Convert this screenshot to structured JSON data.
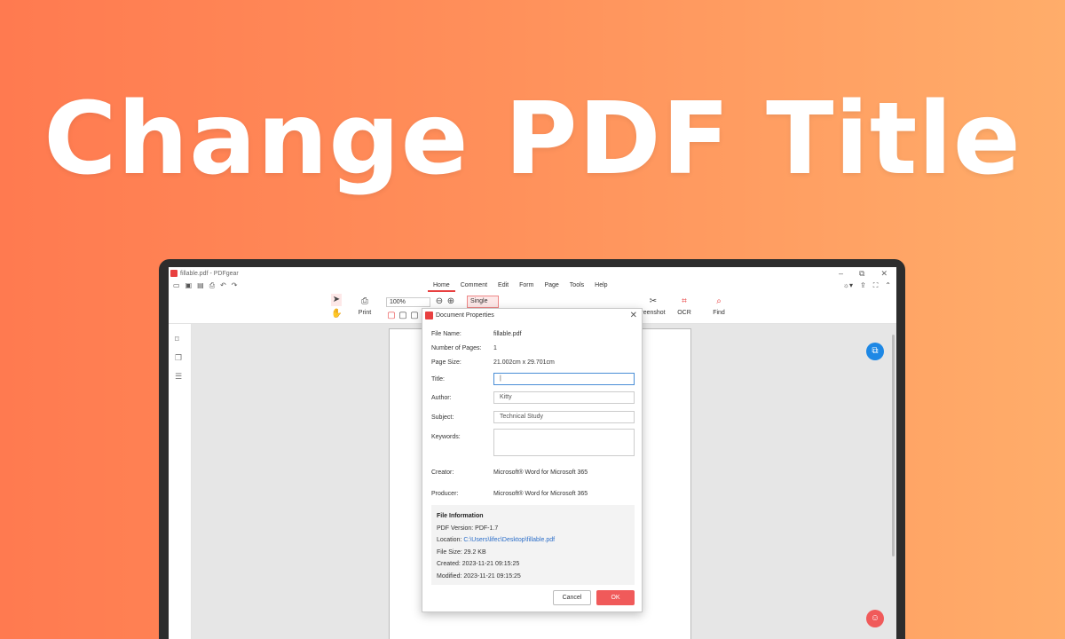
{
  "banner": {
    "title": "Change PDF Title"
  },
  "window": {
    "title": "fillable.pdf - PDFgear",
    "controls": [
      "–",
      "⧉",
      "✕"
    ]
  },
  "menu": {
    "tabs": [
      "Home",
      "Comment",
      "Edit",
      "Form",
      "Page",
      "Tools",
      "Help"
    ],
    "active_tab": "Home"
  },
  "toolbar": {
    "print_label": "Print",
    "zoom_value": "100%",
    "single_label": "Single",
    "screenshot_label": "reenshot",
    "ocr_label": "OCR",
    "find_label": "Find"
  },
  "dialog": {
    "title": "Document Properties",
    "file_name_label": "File Name:",
    "file_name_value": "fillable.pdf",
    "pages_label": "Number of Pages:",
    "pages_value": "1",
    "page_size_label": "Page Size:",
    "page_size_value": "21.002cm x 29.701cm",
    "title_label": "Title:",
    "title_value": "|",
    "author_label": "Author:",
    "author_value": "Kitty",
    "subject_label": "Subject:",
    "subject_value": "Technical Study",
    "keywords_label": "Keywords:",
    "keywords_value": "",
    "creator_label": "Creator:",
    "creator_value": "Microsoft® Word for Microsoft 365",
    "producer_label": "Producer:",
    "producer_value": "Microsoft® Word for Microsoft 365",
    "info": {
      "heading": "File Information",
      "pdf_version": "PDF Version: PDF-1.7",
      "location_label": "Location: ",
      "location_value": "C:\\Users\\lifec\\Desktop\\fillable.pdf",
      "file_size": "File Size: 29.2 KB",
      "created": "Created: 2023-11-21 09:15:25",
      "modified": "Modified: 2023-11-21 09:15:25"
    },
    "cancel_label": "Cancel",
    "ok_label": "OK"
  },
  "colors": {
    "accent": "#e84040",
    "ok_button": "#f05a5a",
    "blue_fab": "#1e88e5",
    "red_fab": "#f05a5a"
  }
}
